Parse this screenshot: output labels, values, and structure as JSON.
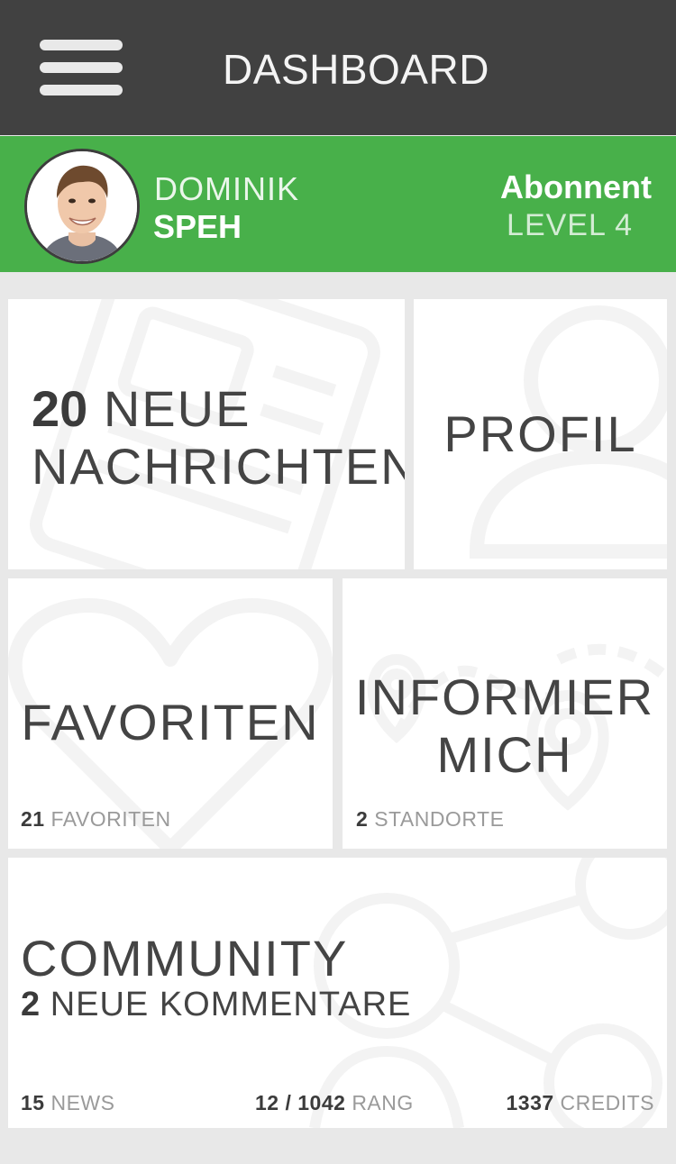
{
  "header": {
    "title": "DASHBOARD",
    "menu_icon": "hamburger-menu-icon"
  },
  "user": {
    "first_name": "DOMINIK",
    "last_name": "SPEH",
    "subscription": "Abonnent",
    "level": "LEVEL 4"
  },
  "tiles": {
    "messages": {
      "count": "20",
      "line1": "NEUE",
      "line2": "NACHRICHTEN",
      "icon": "newspaper-icon"
    },
    "profile": {
      "label": "PROFIL",
      "icon": "user-icon"
    },
    "favorites": {
      "label": "FAVORITEN",
      "count": "21",
      "count_label": "FAVORITEN",
      "icon": "heart-icon"
    },
    "inform": {
      "line1": "INFORMIER",
      "line2": "MICH",
      "count": "2",
      "count_label": "STANDORTE",
      "icon": "map-pin-icon"
    },
    "community": {
      "label": "COMMUNITY",
      "comments_count": "2",
      "comments_label": "NEUE KOMMENTARE",
      "news_count": "15",
      "news_label": "NEWS",
      "rank": "12 / 1042",
      "rank_label": "RANG",
      "credits": "1337",
      "credits_label": "CREDITS",
      "icon": "network-icon"
    }
  },
  "colors": {
    "topbar": "#414141",
    "accent_green": "#48b04a",
    "background": "#e8e8e8",
    "tile": "#ffffff"
  }
}
